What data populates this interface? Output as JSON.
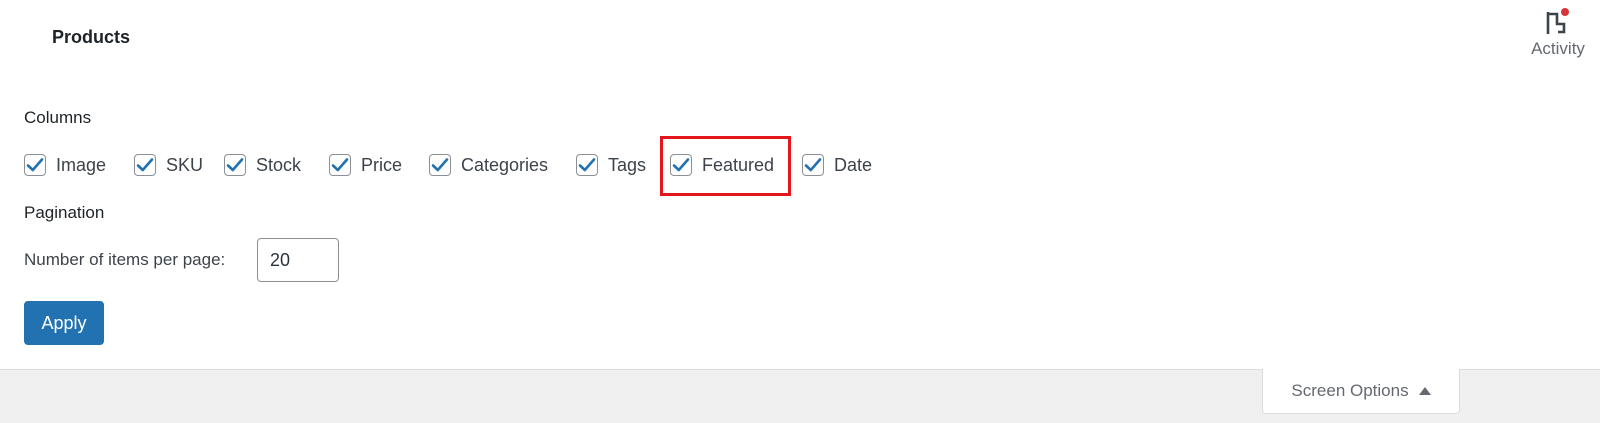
{
  "header": {
    "title": "Products",
    "activity": {
      "label": "Activity",
      "icon": "activity-flag-icon",
      "badge_color": "#d63638"
    }
  },
  "columns": {
    "title": "Columns",
    "items": [
      {
        "label": "Image",
        "checked": true
      },
      {
        "label": "SKU",
        "checked": true
      },
      {
        "label": "Stock",
        "checked": true
      },
      {
        "label": "Price",
        "checked": true
      },
      {
        "label": "Categories",
        "checked": true
      },
      {
        "label": "Tags",
        "checked": true
      },
      {
        "label": "Featured",
        "checked": true
      },
      {
        "label": "Date",
        "checked": true
      }
    ]
  },
  "pagination": {
    "title": "Pagination",
    "per_page_label": "Number of items per page:",
    "per_page_value": "20"
  },
  "apply_label": "Apply",
  "screen_options": {
    "label": "Screen Options",
    "icon": "caret-up-icon"
  },
  "colors": {
    "accent": "#2271b1",
    "highlight": "#e3161b",
    "check": "#2271b1"
  }
}
